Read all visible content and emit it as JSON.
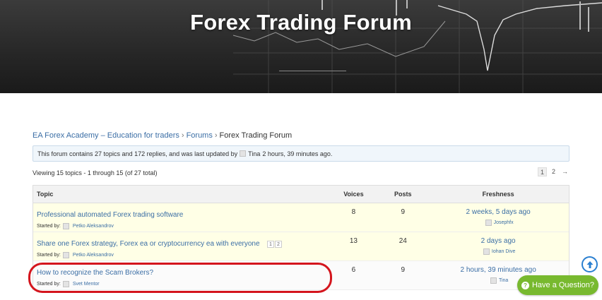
{
  "hero": {
    "title": "Forex Trading Forum"
  },
  "breadcrumb": {
    "items": [
      "EA Forex Academy – Education for traders",
      "Forums",
      "Forex Trading Forum"
    ],
    "separator": "›"
  },
  "info": {
    "text": "This forum contains 27 topics and 172 replies, and was last updated by",
    "user": "Tina",
    "time": "2 hours, 39 minutes ago."
  },
  "viewing": "Viewing 15 topics - 1 through 15 (of 27 total)",
  "pagination": {
    "current": "1",
    "next_page": "2",
    "next_arrow": "→"
  },
  "table": {
    "headers": {
      "topic": "Topic",
      "voices": "Voices",
      "posts": "Posts",
      "freshness": "Freshness"
    },
    "started_label": "Started by:",
    "rows": [
      {
        "title": "Professional automated Forex trading software",
        "author": "Petko Aleksandrov",
        "voices": "8",
        "posts": "9",
        "freshness": "2 weeks, 5 days ago",
        "last_user": "Josephfx",
        "pages": []
      },
      {
        "title": "Share one Forex strategy, Forex ea or cryptocurrency ea with everyone",
        "author": "Petko Aleksandrov",
        "voices": "13",
        "posts": "24",
        "freshness": "2 days ago",
        "last_user": "Iohan Dive",
        "pages": [
          "1",
          "2"
        ]
      },
      {
        "title": "How to recognize the Scam Brokers?",
        "author": "Svet Mentor",
        "voices": "6",
        "posts": "9",
        "freshness": "2 hours, 39 minutes ago",
        "last_user": "Tina",
        "pages": []
      }
    ]
  },
  "widgets": {
    "question_label": "Have a Question?",
    "question_icon": "question-icon",
    "scroll_icon": "arrow-up-icon"
  },
  "colors": {
    "link": "#3b6ea5",
    "sticky_bg": "#ffffe6",
    "question_bg": "#78b92f",
    "highlight": "#d4151d",
    "scroll": "#2a7fd0"
  }
}
